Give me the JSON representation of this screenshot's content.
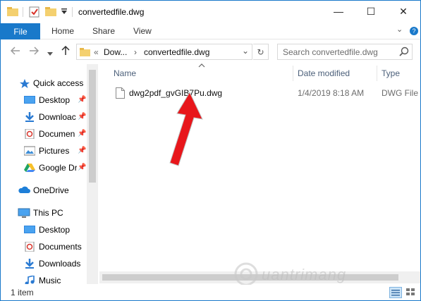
{
  "window": {
    "title": "convertedfile.dwg",
    "controls": {
      "minimize": "—",
      "maximize": "☐",
      "close": "✕"
    }
  },
  "ribbon": {
    "tabs": [
      "File",
      "Home",
      "Share",
      "View"
    ],
    "collapse_glyph": "⌄",
    "help_glyph": "?"
  },
  "address": {
    "overflow": "«",
    "crumb1": "Dow...",
    "separator": "›",
    "crumb2": "convertedfile.dwg",
    "dropdown": "⌄",
    "refresh": "↻",
    "search_placeholder": "Search convertedfile.dwg"
  },
  "nav": {
    "quick_access": "Quick access",
    "quick_items": [
      {
        "label": "Desktop",
        "icon": "desktop-icon"
      },
      {
        "label": "Downloac",
        "icon": "download-icon"
      },
      {
        "label": "Documen",
        "icon": "documents-icon"
      },
      {
        "label": "Pictures",
        "icon": "pictures-icon"
      },
      {
        "label": "Google Dr",
        "icon": "google-drive-icon"
      }
    ],
    "onedrive": "OneDrive",
    "this_pc": "This PC",
    "pc_items": [
      {
        "label": "Desktop",
        "icon": "desktop-icon"
      },
      {
        "label": "Documents",
        "icon": "documents-icon"
      },
      {
        "label": "Downloads",
        "icon": "download-icon"
      },
      {
        "label": "Music",
        "icon": "music-icon"
      }
    ]
  },
  "columns": {
    "name": "Name",
    "date": "Date modified",
    "type": "Type"
  },
  "files": [
    {
      "name": "dwg2pdf_gvGIB7Pu.dwg",
      "date": "1/4/2019 8:18 AM",
      "type": "DWG File"
    }
  ],
  "status": {
    "items": "1 item"
  },
  "watermark": "uantrimang",
  "colors": {
    "accent": "#1979ca",
    "arrow": "#e8161b"
  }
}
